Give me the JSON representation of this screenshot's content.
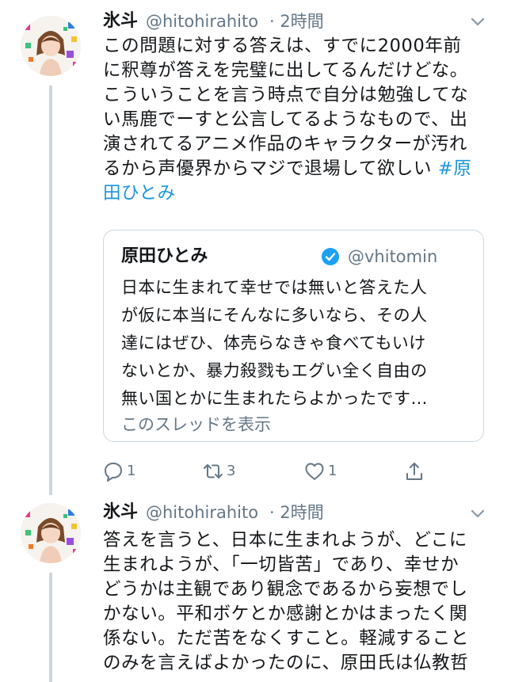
{
  "tweets": [
    {
      "name": "氷斗",
      "handle": "@hitohirahito",
      "time": "· 2時間",
      "lines": [
        "この問題に対する答えは、すでに2000年前",
        "に釈尊が答えを完璧に出してるんだけどな。",
        "こういうことを言う時点で自分は勉強してな",
        "い馬鹿でーすと公言してるようなもので、出",
        "演されてるアニメ作品のキャラクターが汚れ",
        "るから声優界からマジで退場して欲しい "
      ],
      "hashtag_a": "#原",
      "hashtag_b": "田ひとみ",
      "quote": {
        "name": "原田ひとみ",
        "handle": "@vhitomin",
        "lines": [
          "日本に生まれて幸せでは無いと答えた人",
          "が仮に本当にそんなに多いなら、その人",
          "達にはぜひ、体売らなきゃ食べてもいけ",
          "ないとか、暴力殺戮もエグい全く自由の",
          "無い国とかに生まれたらよかったです…"
        ],
        "show_thread": "このスレッドを表示"
      },
      "actions": {
        "reply_count": "1",
        "retweet_count": "3",
        "like_count": "1"
      },
      "icons": [
        "reply-icon",
        "retweet-icon",
        "like-icon",
        "share-icon",
        "chevron-down-icon",
        "verified-badge-icon"
      ]
    },
    {
      "name": "氷斗",
      "handle": "@hitohirahito",
      "time": "· 2時間",
      "lines": [
        "答えを言うと、日本に生まれようが、どこに",
        "生まれようが、「一切皆苦」であり、幸せか",
        "どうかは主観であり観念であるから妄想でし",
        "かない。平和ボケとか感謝とかはまったく関",
        "係ない。ただ苦をなくすこと。軽減すること",
        "のみを言えばよかったのに、原田氏は仏教哲"
      ]
    }
  ],
  "colors": {
    "text": "#14171a",
    "secondary": "#657786",
    "link": "#1b95e0",
    "border": "#ccd6dd"
  }
}
